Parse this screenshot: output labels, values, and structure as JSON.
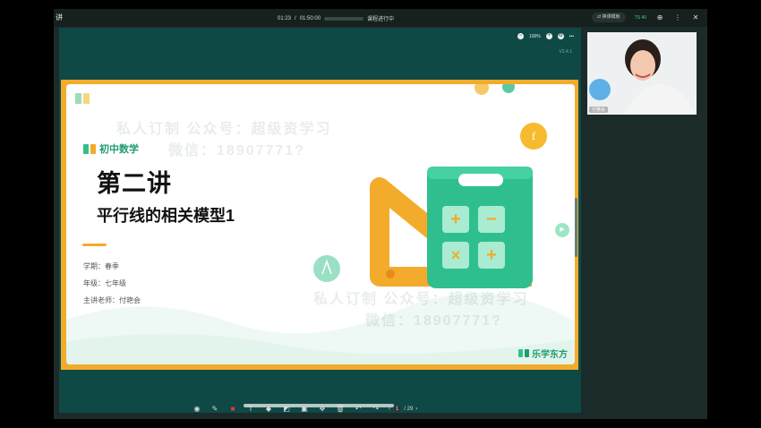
{
  "window": {
    "title": "讲",
    "time_current": "01:23",
    "time_total": "01:50:00",
    "time_separator": "/",
    "status": "课程进行中",
    "switch_button": "换课模板",
    "signal": "TS 40"
  },
  "stage": {
    "zoom": "100%",
    "version": "V2.4.1"
  },
  "slide": {
    "subject": "初中数学",
    "lecture": "第二讲",
    "subtitle": "平行线的相关模型1",
    "term": "学期：春季",
    "grade": "年级：七年级",
    "teacher": "主讲老师：付艳会",
    "watermark_line1": "私人订制 公众号：超级资学习",
    "watermark_line2": "微信：18907771?",
    "brand": "乐学东方"
  },
  "pager": {
    "current": "1",
    "total": "/ 29"
  },
  "camera": {
    "name": "付艳会"
  },
  "colors": {
    "accent_green": "#1f9c6e",
    "slide_border": "#f3ab2c",
    "stage_bg": "#0f4945",
    "calc_green": "#2fbf8f"
  }
}
